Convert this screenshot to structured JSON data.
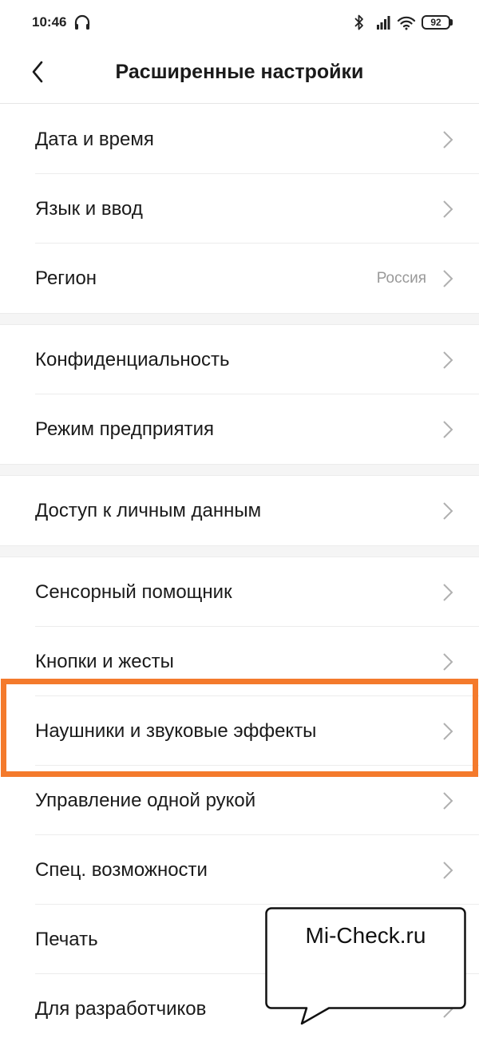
{
  "status_bar": {
    "time": "10:46",
    "battery": "92"
  },
  "header": {
    "title": "Расширенные настройки",
    "back_icon": "chevron-left-icon"
  },
  "groups": [
    {
      "items": [
        {
          "label": "Дата и время",
          "value": ""
        },
        {
          "label": "Язык и ввод",
          "value": ""
        },
        {
          "label": "Регион",
          "value": "Россия"
        }
      ]
    },
    {
      "items": [
        {
          "label": "Конфиденциальность",
          "value": ""
        },
        {
          "label": "Режим предприятия",
          "value": ""
        }
      ]
    },
    {
      "items": [
        {
          "label": "Доступ к личным данным",
          "value": ""
        }
      ]
    },
    {
      "items": [
        {
          "label": "Сенсорный помощник",
          "value": ""
        },
        {
          "label": "Кнопки и жесты",
          "value": ""
        },
        {
          "label": "Наушники и звуковые эффекты",
          "value": ""
        },
        {
          "label": "Управление одной рукой",
          "value": ""
        },
        {
          "label": "Спец. возможности",
          "value": ""
        },
        {
          "label": "Печать",
          "value": ""
        },
        {
          "label": "Для разработчиков",
          "value": ""
        }
      ]
    }
  ],
  "watermark": {
    "text": "Mi-Check.ru"
  },
  "colors": {
    "highlight": "#f47a2c",
    "value_text": "#999999",
    "chevron": "#b0b0b0"
  }
}
